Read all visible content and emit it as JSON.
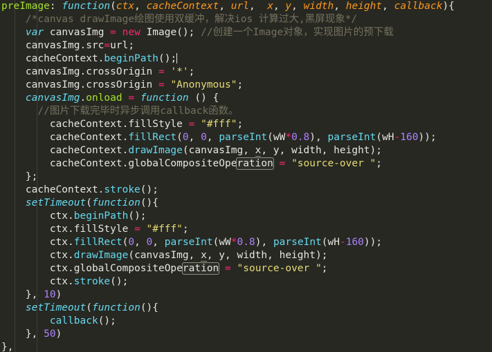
{
  "editor": {
    "language": "javascript",
    "background_color": "#272822",
    "foreground_color": "#e6e6e1",
    "font_size_px": 14.5,
    "line_height_px": 19,
    "indent_guides": true,
    "colors": {
      "property": "#a6e22e",
      "keyword": "#66d9ef",
      "operator": "#f92672",
      "parameter": "#fd971f",
      "string": "#e6db74",
      "number": "#ae81ff",
      "comment": "#75715e",
      "plain": "#e6e6e1",
      "highlight_box_border": "#8f9080"
    }
  },
  "code": {
    "lines": [
      {
        "n": 1,
        "text": "preImage: function(ctx, cacheContext, url,  x, y, width, height, callback){",
        "tokens": [
          {
            "t": "preImage",
            "c": "prop"
          },
          {
            "t": ": ",
            "c": "plain"
          },
          {
            "t": "function",
            "c": "kw"
          },
          {
            "t": "(",
            "c": "plain"
          },
          {
            "t": "ctx",
            "c": "param"
          },
          {
            "t": ", ",
            "c": "plain"
          },
          {
            "t": "cacheContext",
            "c": "param"
          },
          {
            "t": ", ",
            "c": "plain"
          },
          {
            "t": "url",
            "c": "param"
          },
          {
            "t": ",  ",
            "c": "plain"
          },
          {
            "t": "x",
            "c": "param"
          },
          {
            "t": ", ",
            "c": "plain"
          },
          {
            "t": "y",
            "c": "param"
          },
          {
            "t": ", ",
            "c": "plain"
          },
          {
            "t": "width",
            "c": "param"
          },
          {
            "t": ", ",
            "c": "plain"
          },
          {
            "t": "height",
            "c": "param"
          },
          {
            "t": ", ",
            "c": "plain"
          },
          {
            "t": "callback",
            "c": "param"
          },
          {
            "t": "){",
            "c": "plain"
          }
        ]
      },
      {
        "n": 2,
        "text": "    /*canvas drawImage绘图使用双缓冲，解决ios 计算过大,黑屏现象*/",
        "tokens": [
          {
            "t": "    ",
            "c": "plain"
          },
          {
            "t": "/*canvas drawImage绘图使用双缓冲，解决ios 计算过大,黑屏现象*/",
            "c": "comment"
          }
        ]
      },
      {
        "n": 3,
        "text": "    var canvasImg = new Image(); //创建一个Image对象，实现图片的预下载",
        "tokens": [
          {
            "t": "    ",
            "c": "plain"
          },
          {
            "t": "var",
            "c": "kw2"
          },
          {
            "t": " canvasImg ",
            "c": "plain"
          },
          {
            "t": "=",
            "c": "op"
          },
          {
            "t": " ",
            "c": "plain"
          },
          {
            "t": "new",
            "c": "op"
          },
          {
            "t": " Image(); ",
            "c": "plain"
          },
          {
            "t": "//创建一个Image对象，实现图片的预下载",
            "c": "comment"
          }
        ]
      },
      {
        "n": 4,
        "text": "    canvasImg.src=url;",
        "tokens": [
          {
            "t": "    canvasImg.src",
            "c": "plain"
          },
          {
            "t": "=",
            "c": "op"
          },
          {
            "t": "url;",
            "c": "plain"
          }
        ]
      },
      {
        "n": 5,
        "text": "    cacheContext.beginPath();",
        "caret_after": true,
        "tokens": [
          {
            "t": "    cacheContext.",
            "c": "plain"
          },
          {
            "t": "beginPath",
            "c": "method"
          },
          {
            "t": "();",
            "c": "plain"
          }
        ]
      },
      {
        "n": 6,
        "text": "    canvasImg.crossOrigin = '*';",
        "tokens": [
          {
            "t": "    canvasImg.crossOrigin ",
            "c": "plain"
          },
          {
            "t": "=",
            "c": "op"
          },
          {
            "t": " ",
            "c": "plain"
          },
          {
            "t": "'*'",
            "c": "str"
          },
          {
            "t": ";",
            "c": "plain"
          }
        ]
      },
      {
        "n": 7,
        "text": "    canvasImg.crossOrigin = \"Anonymous\";",
        "tokens": [
          {
            "t": "    canvasImg.crossOrigin ",
            "c": "plain"
          },
          {
            "t": "=",
            "c": "op"
          },
          {
            "t": " ",
            "c": "plain"
          },
          {
            "t": "\"Anonymous\"",
            "c": "str"
          },
          {
            "t": ";",
            "c": "plain"
          }
        ]
      },
      {
        "n": 8,
        "text": "    canvasImg.onload = function () {",
        "tokens": [
          {
            "t": "    ",
            "c": "plain"
          },
          {
            "t": "canvasImg",
            "c": "ident"
          },
          {
            "t": ".",
            "c": "plain"
          },
          {
            "t": "onload",
            "c": "prop"
          },
          {
            "t": " ",
            "c": "plain"
          },
          {
            "t": "=",
            "c": "op"
          },
          {
            "t": " ",
            "c": "plain"
          },
          {
            "t": "function",
            "c": "kw"
          },
          {
            "t": " () {",
            "c": "plain"
          }
        ]
      },
      {
        "n": 9,
        "text": "      //图片下载完毕时异步调用callback函数。",
        "tokens": [
          {
            "t": "      ",
            "c": "plain"
          },
          {
            "t": "//图片下载完毕时异步调用callback函数。",
            "c": "comment"
          }
        ]
      },
      {
        "n": 10,
        "text": "        cacheContext.fillStyle = \"#fff\";",
        "tokens": [
          {
            "t": "        cacheContext.fillStyle ",
            "c": "plain"
          },
          {
            "t": "=",
            "c": "op"
          },
          {
            "t": " ",
            "c": "plain"
          },
          {
            "t": "\"#fff\"",
            "c": "str"
          },
          {
            "t": ";",
            "c": "plain"
          }
        ]
      },
      {
        "n": 11,
        "text": "        cacheContext.fillRect(0, 0, parseInt(wW*0.8), parseInt(wH-160));",
        "tokens": [
          {
            "t": "        cacheContext.",
            "c": "plain"
          },
          {
            "t": "fillRect",
            "c": "method"
          },
          {
            "t": "(",
            "c": "plain"
          },
          {
            "t": "0",
            "c": "num"
          },
          {
            "t": ", ",
            "c": "plain"
          },
          {
            "t": "0",
            "c": "num"
          },
          {
            "t": ", ",
            "c": "plain"
          },
          {
            "t": "parseInt",
            "c": "method"
          },
          {
            "t": "(wW",
            "c": "plain"
          },
          {
            "t": "*",
            "c": "op"
          },
          {
            "t": "0.8",
            "c": "num"
          },
          {
            "t": "), ",
            "c": "plain"
          },
          {
            "t": "parseInt",
            "c": "method"
          },
          {
            "t": "(wH",
            "c": "plain"
          },
          {
            "t": "-",
            "c": "op"
          },
          {
            "t": "160",
            "c": "num"
          },
          {
            "t": "));",
            "c": "plain"
          }
        ]
      },
      {
        "n": 12,
        "text": "        cacheContext.drawImage(canvasImg, x, y, width, height);",
        "underline_token": "x",
        "tokens": [
          {
            "t": "        cacheContext.",
            "c": "plain"
          },
          {
            "t": "drawImage",
            "c": "method"
          },
          {
            "t": "(canvasImg, ",
            "c": "plain"
          },
          {
            "t": "x",
            "c": "plain",
            "underline": true
          },
          {
            "t": ", y, width, height);",
            "c": "plain"
          }
        ]
      },
      {
        "n": 13,
        "text": "        cacheContext.globalCompositeOperation = \"source-over \";",
        "boxed_token": "ration",
        "tokens": [
          {
            "t": "        cacheContext.globalCompositeOpe",
            "c": "plain"
          },
          {
            "t": "ration",
            "c": "plain",
            "boxed": true
          },
          {
            "t": " ",
            "c": "plain"
          },
          {
            "t": "=",
            "c": "op"
          },
          {
            "t": " ",
            "c": "plain"
          },
          {
            "t": "\"source-over \"",
            "c": "str"
          },
          {
            "t": ";",
            "c": "plain"
          }
        ]
      },
      {
        "n": 14,
        "text": "    };",
        "tokens": [
          {
            "t": "    };",
            "c": "plain"
          }
        ]
      },
      {
        "n": 15,
        "text": "    cacheContext.stroke();",
        "tokens": [
          {
            "t": "    cacheContext.",
            "c": "plain"
          },
          {
            "t": "stroke",
            "c": "method"
          },
          {
            "t": "();",
            "c": "plain"
          }
        ]
      },
      {
        "n": 16,
        "text": "    setTimeout(function(){",
        "tokens": [
          {
            "t": "    ",
            "c": "plain"
          },
          {
            "t": "setTimeout",
            "c": "ident"
          },
          {
            "t": "(",
            "c": "plain"
          },
          {
            "t": "function",
            "c": "kw"
          },
          {
            "t": "(){",
            "c": "plain"
          }
        ]
      },
      {
        "n": 17,
        "text": "        ctx.beginPath();",
        "tokens": [
          {
            "t": "        ctx.",
            "c": "plain"
          },
          {
            "t": "beginPath",
            "c": "method"
          },
          {
            "t": "();",
            "c": "plain"
          }
        ]
      },
      {
        "n": 18,
        "text": "        ctx.fillStyle = \"#fff\";",
        "tokens": [
          {
            "t": "        ctx.fillStyle ",
            "c": "plain"
          },
          {
            "t": "=",
            "c": "op"
          },
          {
            "t": " ",
            "c": "plain"
          },
          {
            "t": "\"#fff\"",
            "c": "str"
          },
          {
            "t": ";",
            "c": "plain"
          }
        ]
      },
      {
        "n": 19,
        "text": "        ctx.fillRect(0, 0, parseInt(wW*0.8), parseInt(wH-160));",
        "tokens": [
          {
            "t": "        ctx.",
            "c": "plain"
          },
          {
            "t": "fillRect",
            "c": "method"
          },
          {
            "t": "(",
            "c": "plain"
          },
          {
            "t": "0",
            "c": "num"
          },
          {
            "t": ", ",
            "c": "plain"
          },
          {
            "t": "0",
            "c": "num"
          },
          {
            "t": ", ",
            "c": "plain"
          },
          {
            "t": "parseInt",
            "c": "method"
          },
          {
            "t": "(wW",
            "c": "plain"
          },
          {
            "t": "*",
            "c": "op"
          },
          {
            "t": "0.8",
            "c": "num"
          },
          {
            "t": "), ",
            "c": "plain"
          },
          {
            "t": "parseInt",
            "c": "method"
          },
          {
            "t": "(wH",
            "c": "plain"
          },
          {
            "t": "-",
            "c": "op"
          },
          {
            "t": "160",
            "c": "num"
          },
          {
            "t": "));",
            "c": "plain"
          }
        ]
      },
      {
        "n": 20,
        "text": "        ctx.drawImage(canvasImg, x, y, width, height);",
        "underline_token": "x",
        "tokens": [
          {
            "t": "        ctx.",
            "c": "plain"
          },
          {
            "t": "drawImage",
            "c": "method"
          },
          {
            "t": "(canvasImg, ",
            "c": "plain"
          },
          {
            "t": "x",
            "c": "plain",
            "underline": true
          },
          {
            "t": ", y, width, height);",
            "c": "plain"
          }
        ]
      },
      {
        "n": 21,
        "text": "        ctx.globalCompositeOperation = \"source-over \";",
        "boxed_token": "ration",
        "tokens": [
          {
            "t": "        ctx.globalCompositeOpe",
            "c": "plain"
          },
          {
            "t": "ration",
            "c": "plain",
            "boxed": true
          },
          {
            "t": " ",
            "c": "plain"
          },
          {
            "t": "=",
            "c": "op"
          },
          {
            "t": " ",
            "c": "plain"
          },
          {
            "t": "\"source-over \"",
            "c": "str"
          },
          {
            "t": ";",
            "c": "plain"
          }
        ]
      },
      {
        "n": 22,
        "text": "        ctx.stroke();",
        "tokens": [
          {
            "t": "        ctx.",
            "c": "plain"
          },
          {
            "t": "stroke",
            "c": "method"
          },
          {
            "t": "();",
            "c": "plain"
          }
        ]
      },
      {
        "n": 23,
        "text": "    }, 10)",
        "tokens": [
          {
            "t": "    }, ",
            "c": "plain"
          },
          {
            "t": "10",
            "c": "num"
          },
          {
            "t": ")",
            "c": "plain"
          }
        ]
      },
      {
        "n": 24,
        "text": "    setTimeout(function(){",
        "tokens": [
          {
            "t": "    ",
            "c": "plain"
          },
          {
            "t": "setTimeout",
            "c": "ident"
          },
          {
            "t": "(",
            "c": "plain"
          },
          {
            "t": "function",
            "c": "kw"
          },
          {
            "t": "(){",
            "c": "plain"
          }
        ]
      },
      {
        "n": 25,
        "text": "        callback();",
        "tokens": [
          {
            "t": "        ",
            "c": "plain"
          },
          {
            "t": "callback",
            "c": "method"
          },
          {
            "t": "();",
            "c": "plain"
          }
        ]
      },
      {
        "n": 26,
        "text": "    }, 50)",
        "tokens": [
          {
            "t": "    }, ",
            "c": "plain"
          },
          {
            "t": "50",
            "c": "num"
          },
          {
            "t": ")",
            "c": "plain"
          }
        ]
      },
      {
        "n": 27,
        "text": "},",
        "tokens": [
          {
            "t": "},",
            "c": "plain"
          }
        ]
      }
    ]
  }
}
